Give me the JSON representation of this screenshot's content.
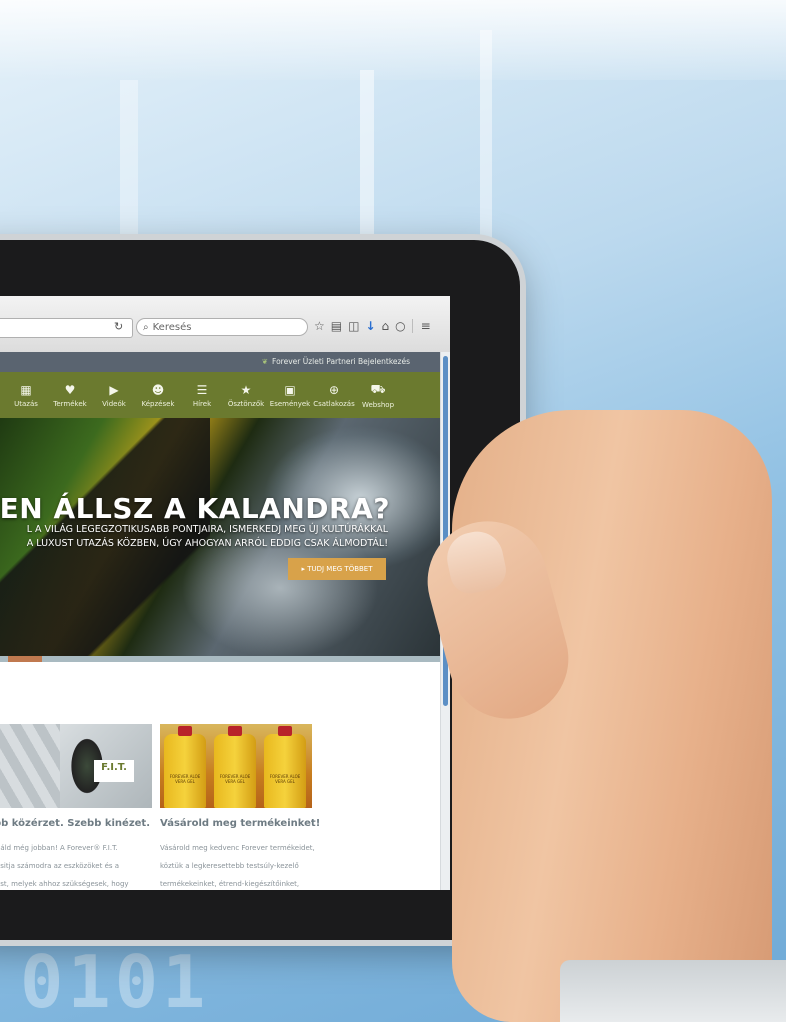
{
  "browser": {
    "search_placeholder": "Keresés",
    "reload_icon": "reload-icon"
  },
  "site": {
    "top_link": "Forever Üzleti Partneri Bejelentkezés",
    "nav": [
      {
        "label": "Utazás",
        "icon": "map-icon"
      },
      {
        "label": "Termékek",
        "icon": "heart-icon"
      },
      {
        "label": "Videók",
        "icon": "play-icon"
      },
      {
        "label": "Képzések",
        "icon": "users-icon"
      },
      {
        "label": "Hírek",
        "icon": "list-icon"
      },
      {
        "label": "Ösztönzők",
        "icon": "star-icon"
      },
      {
        "label": "Események",
        "icon": "briefcase-icon"
      },
      {
        "label": "Csatlakozás",
        "icon": "plus-circle-icon"
      },
      {
        "label": "Webshop",
        "icon": "basket-icon"
      }
    ],
    "hero": {
      "title": "KÉSZEN ÁLLSZ A KALANDRA?",
      "sub1": "L A VILÁG LEGEGZOTIKUSABB PONTJAIRA, ISMERKEDJ MEG ÚJ KULTÚRÁKKAL",
      "sub2": "A LUXUST UTAZÁS KÖZBEN, ÚGY AHOGYAN ARRÓL EDDIG CSAK ÁLMODTÁL!",
      "cta": "▸  TUDJ MEG TÖBBET"
    },
    "cards": [
      {
        "badge": "F.I.T.",
        "title": "bb közérzet. Szebb kinézet.",
        "lines": [
          "náld még jobban! A Forever® F.I.T.",
          "ositja számodra az eszközöket és a",
          "ást, melyek ahhoz szükségesek, hogy"
        ]
      },
      {
        "bottle_label": "FOREVER ALOE VERA GEL",
        "title": "Vásárold meg termékeinket!",
        "lines": [
          "Vásárold meg kedvenc Forever termékeidet,",
          "köztük a legkeresettebb testsúly-kezelő",
          "termékekeinket, étrend-kiegészítőinket,"
        ]
      }
    ]
  },
  "colors": {
    "nav_bg": "#6b7a2f",
    "topbar_bg": "#5a6470",
    "cta_bg": "#d8a24a",
    "card_title": "#6e7b83",
    "scroll_thumb": "#5b8fc5"
  }
}
